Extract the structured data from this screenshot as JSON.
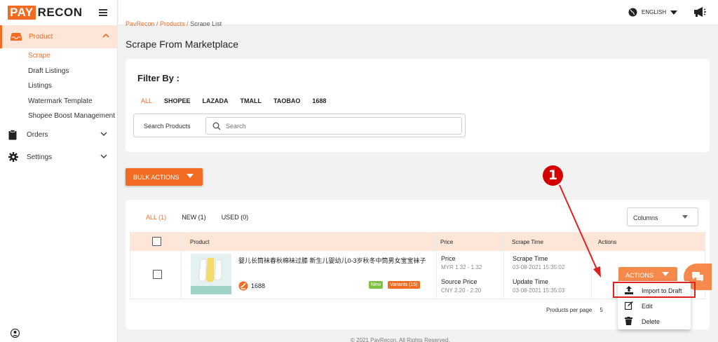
{
  "brand": {
    "pay": "PAY",
    "recon": "RECON",
    "accent": "#f26b21"
  },
  "sidebar": {
    "product_label": "Product",
    "sub_items": [
      "Scrape",
      "Draft Listings",
      "Listings",
      "Watermark Template",
      "Shopee Boost Management"
    ],
    "orders_label": "Orders",
    "settings_label": "Settings"
  },
  "topbar": {
    "language": "ENGLISH"
  },
  "breadcrumb": {
    "root": "PayRecon",
    "section": "Products",
    "current": "Scrape List"
  },
  "page": {
    "title": "Scrape From Marketplace"
  },
  "filter": {
    "title": "Filter By :",
    "marketplaces": [
      "ALL",
      "SHOPEE",
      "LAZADA",
      "TMALL",
      "TAOBAO",
      "1688"
    ],
    "search_label": "Search Products",
    "search_placeholder": "Search"
  },
  "bulk_actions_label": "BULK ACTIONS",
  "list": {
    "tabs": [
      "ALL (1)",
      "NEW (1)",
      "USED (0)"
    ],
    "columns_label": "Columns",
    "headers": {
      "product": "Product",
      "price": "Price",
      "scrape_time": "Scrape Time",
      "actions": "Actions"
    },
    "row": {
      "name": "婴儿长筒袜春秋棉袜过膝 新生儿婴幼儿0-3岁秋冬中筒男女宝宝袜子",
      "source": "1688",
      "badge_new": "New",
      "badge_variants": "Variants (15)",
      "price_label": "Price",
      "price_value": "MYR 1.32 - 1.32",
      "source_price_label": "Source Price",
      "source_price_value": "CNY 2.20 - 2.20",
      "scrape_time_label": "Scrape Time",
      "scrape_time_value": "03-08-2021 15:35:02",
      "update_time_label": "Update Time",
      "update_time_value": "03-08-2021 15:35:03",
      "actions_label": "ACTIONS"
    },
    "pager": {
      "label": "Products per page",
      "value": "5"
    }
  },
  "dropdown": {
    "items": [
      "Import to Draft",
      "Edit",
      "Delete"
    ]
  },
  "annotation": {
    "number": "1"
  },
  "footer": "© 2021 PayRecon. All Rights Reserved."
}
